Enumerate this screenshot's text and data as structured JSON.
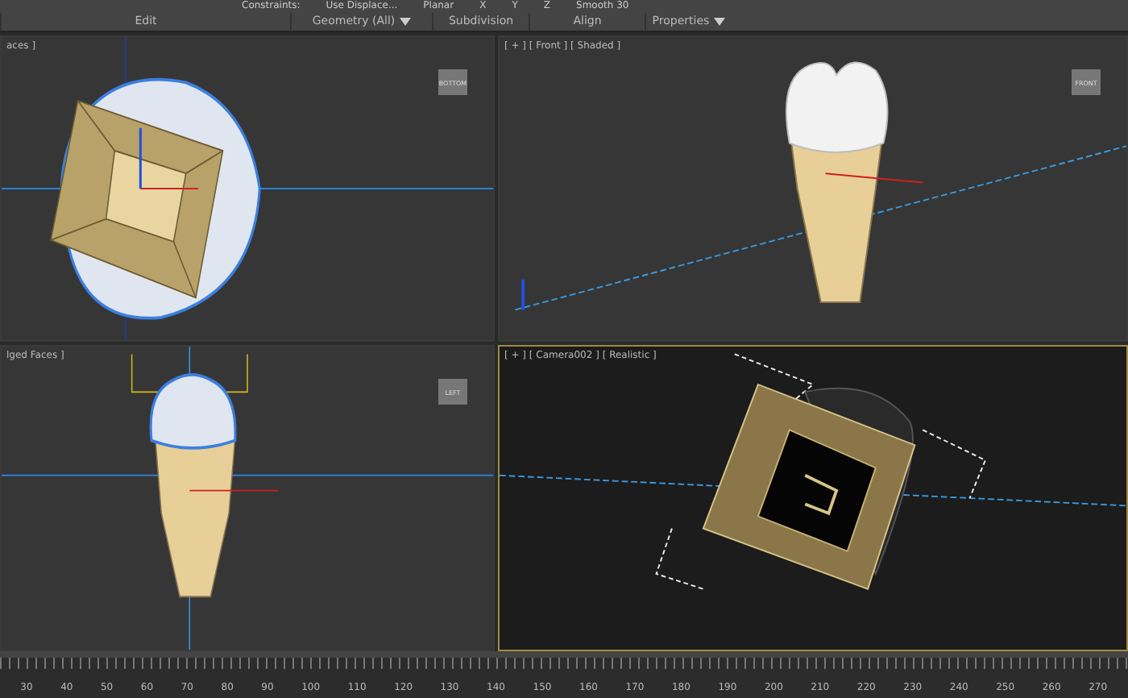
{
  "ribbon": {
    "top_row": [
      "Constraints:",
      "Use Displace...",
      "Planar",
      "X",
      "Y",
      "Z",
      "Smooth 30"
    ],
    "panels": [
      {
        "label": "Edit",
        "dropdown": false
      },
      {
        "label": "Geometry (All)",
        "dropdown": true
      },
      {
        "label": "Subdivision",
        "dropdown": false
      },
      {
        "label": "Align",
        "dropdown": false
      },
      {
        "label": "Properties",
        "dropdown": true
      }
    ]
  },
  "viewports": [
    {
      "label": "aces ]",
      "kind": "top",
      "viewcube": "BOTTOM",
      "active": false
    },
    {
      "label": "[ + ] [ Front ] [ Shaded ]",
      "kind": "front",
      "viewcube": "FRONT",
      "active": false
    },
    {
      "label": "lged Faces ]",
      "kind": "left",
      "viewcube": "LEFT",
      "active": false
    },
    {
      "label": "[ + ] [ Camera002 ] [ Realistic ]",
      "kind": "camera",
      "active": true
    }
  ],
  "timeline": {
    "ticks": [
      "30",
      "40",
      "50",
      "60",
      "70",
      "80",
      "90",
      "100",
      "110",
      "120",
      "130",
      "140",
      "150",
      "160",
      "170",
      "180",
      "190",
      "200",
      "210",
      "220",
      "230",
      "240",
      "250",
      "260",
      "270"
    ]
  }
}
